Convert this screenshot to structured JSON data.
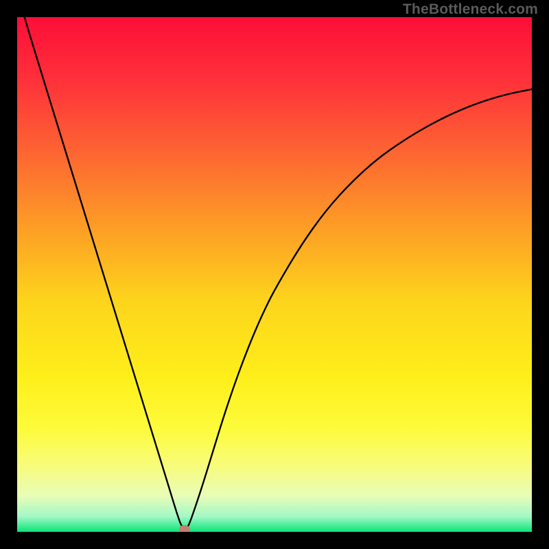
{
  "watermark": "TheBottleneck.com",
  "chart_data": {
    "type": "line",
    "title": "",
    "xlabel": "",
    "ylabel": "",
    "xlim": [
      0,
      100
    ],
    "ylim": [
      0,
      100
    ],
    "x": [
      0,
      2,
      4,
      6,
      8,
      10,
      12,
      14,
      16,
      18,
      20,
      22,
      24,
      26,
      28,
      30,
      31,
      32,
      33,
      34,
      36,
      38,
      40,
      42,
      44,
      46,
      48,
      50,
      55,
      60,
      65,
      70,
      75,
      80,
      85,
      90,
      95,
      100
    ],
    "values": [
      105,
      98,
      91.5,
      85,
      78.5,
      72,
      65.5,
      59,
      52.5,
      46,
      39.5,
      33,
      26.5,
      20,
      13.5,
      7,
      3.7,
      0.8,
      0.5,
      3,
      9,
      15.5,
      22,
      28,
      33.5,
      38.5,
      43,
      47,
      55.5,
      62.5,
      68,
      72.5,
      76,
      79,
      81.5,
      83.5,
      85,
      86
    ],
    "marker": {
      "x": 32.5,
      "y": 0.5
    },
    "gradient_stops": [
      {
        "pos": 0.0,
        "color": "#fd0e38"
      },
      {
        "pos": 0.12,
        "color": "#fe303a"
      },
      {
        "pos": 0.25,
        "color": "#fd6033"
      },
      {
        "pos": 0.4,
        "color": "#fd9a26"
      },
      {
        "pos": 0.55,
        "color": "#fdd41c"
      },
      {
        "pos": 0.7,
        "color": "#feef1a"
      },
      {
        "pos": 0.8,
        "color": "#fdfb3b"
      },
      {
        "pos": 0.87,
        "color": "#f8fc7a"
      },
      {
        "pos": 0.93,
        "color": "#e8fdb7"
      },
      {
        "pos": 0.97,
        "color": "#a3f8c6"
      },
      {
        "pos": 1.0,
        "color": "#09e577"
      }
    ],
    "marker_color": "#c77e6f",
    "curve_color": "#000000"
  }
}
